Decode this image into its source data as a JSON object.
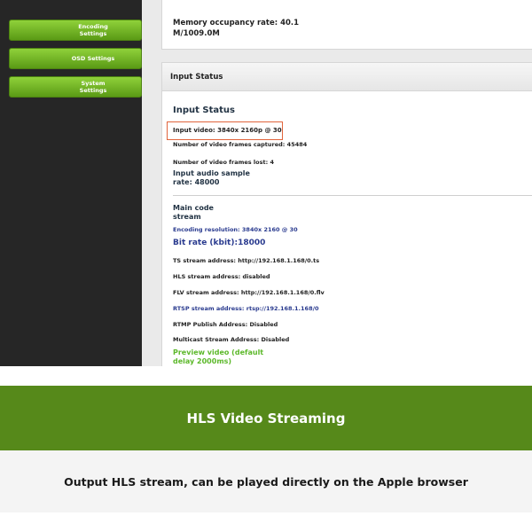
{
  "sidebar": {
    "items": [
      {
        "label": "Encoding Settings"
      },
      {
        "label": "OSD Settings"
      },
      {
        "label": "System Settings"
      }
    ]
  },
  "memory": {
    "text": "Memory occupancy rate: 40.1 M/1009.0M"
  },
  "input_panel": {
    "header": "Input Status",
    "title": "Input Status",
    "input_video": "Input video: 3840x 2160p @ 30",
    "frames_captured": "Number of video frames captured: 45484",
    "frames_lost": "Number of video frames lost: 4",
    "audio_rate": "Input audio sample rate: 48000",
    "main_code_stream": "Main code stream",
    "encoding_resolution": "Encoding resolution: 3840x 2160 @ 30",
    "bit_rate": "Bit rate (kbit):18000",
    "ts_address": "TS stream address: http://192.168.1.168/0.ts",
    "hls_address": "HLS stream address: disabled",
    "flv_address": "FLV stream address: http://192.168.1.168/0.flv",
    "rtsp_address": "RTSP stream address: rtsp://192.168.1.168/0",
    "rtmp_address": "RTMP Publish Address: Disabled",
    "multicast_address": "Multicast Stream Address: Disabled",
    "preview_link": "Preview video (default delay 2000ms)"
  },
  "banner": {
    "title": "HLS Video Streaming",
    "subtitle": "Output HLS stream, can be played directly on the Apple browser"
  },
  "colors": {
    "accent_green": "#56891a",
    "button_green": "#7bbf2a",
    "sidebar_dark": "#262626",
    "highlight_orange": "#e0643c"
  }
}
